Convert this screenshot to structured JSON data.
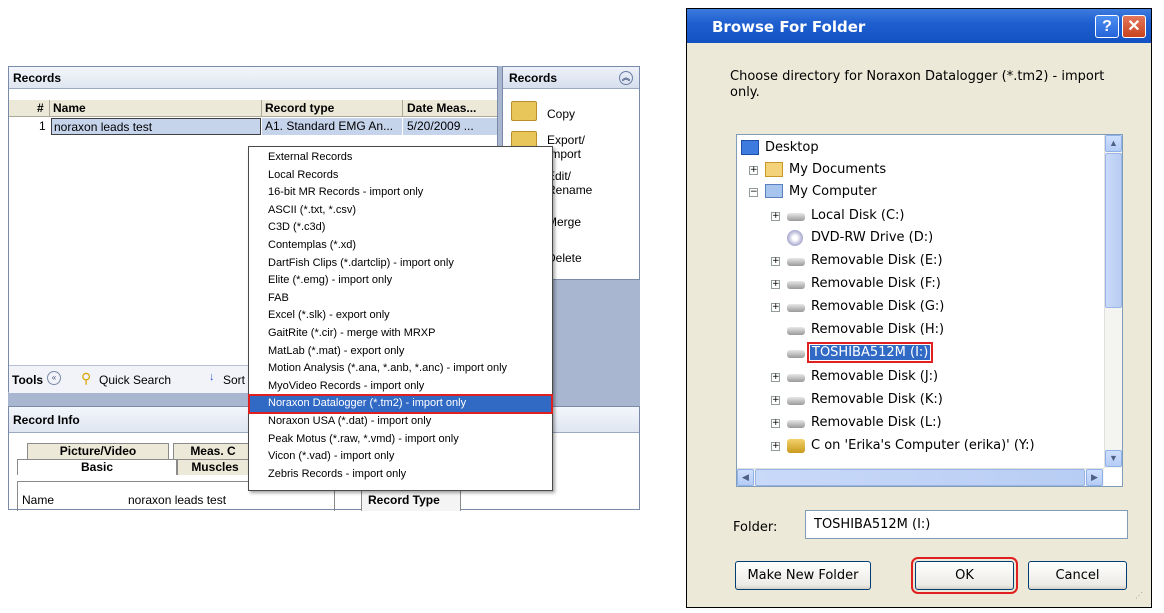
{
  "app": {
    "records_panel": {
      "title": "Records",
      "columns": [
        "#",
        "Name",
        "Record type",
        "Date Meas..."
      ],
      "rows": [
        {
          "num": "1",
          "name": "noraxon leads test",
          "type": "A1. Standard EMG An...",
          "date": "5/20/2009 ..."
        }
      ]
    },
    "tools_bar": {
      "tools_label": "Tools",
      "quick_search": "Quick Search",
      "sort": "Sort"
    },
    "side_panel": {
      "title": "Records",
      "items": [
        {
          "label": "Copy"
        },
        {
          "label": "Export/ Import"
        },
        {
          "label": "Edit/ Rename"
        },
        {
          "label": "Merge"
        },
        {
          "label": "Delete"
        }
      ]
    },
    "record_info": {
      "title": "Record Info",
      "tabs_top": [
        "Picture/Video",
        "Meas. C"
      ],
      "tabs_bottom": [
        "Basic",
        "Muscles"
      ],
      "name_label": "Name",
      "name_value": "noraxon leads test",
      "record_type_label": "Record Type"
    },
    "context_menu": {
      "items": [
        "External Records",
        "Local Records",
        "16-bit MR Records - import only",
        "ASCII (*.txt, *.csv)",
        "C3D (*.c3d)",
        "Contemplas (*.xd)",
        "DartFish Clips (*.dartclip) - import only",
        "Elite (*.emg) - import only",
        "FAB",
        "Excel (*.slk) - export only",
        "GaitRite (*.cir) - merge with MRXP",
        "MatLab (*.mat) - export only",
        "Motion Analysis (*.ana, *.anb, *.anc) - import only",
        "MyoVideo Records - import only",
        "Noraxon Datalogger (*.tm2) - import only",
        "Noraxon USA (*.dat) - import only",
        "Peak Motus (*.raw, *.vmd) - import only",
        "Vicon (*.vad) - import only",
        "Zebris Records - import only"
      ],
      "highlighted": "Noraxon Datalogger (*.tm2) - import only"
    }
  },
  "dialog": {
    "title": "Browse For Folder",
    "help_glyph": "?",
    "close_glyph": "✕",
    "instruction": "Choose directory for Noraxon Datalogger (*.tm2) - import only.",
    "tree": [
      {
        "label": "Desktop",
        "icon": "desktop-icon"
      },
      {
        "label": "My Documents",
        "icon": "my-documents-icon"
      },
      {
        "label": "My Computer",
        "icon": "my-computer-icon"
      },
      {
        "label": "Local Disk (C:)",
        "icon": "local-disk-icon"
      },
      {
        "label": "DVD-RW Drive (D:)",
        "icon": "dvd-drive-icon"
      },
      {
        "label": "Removable Disk (E:)",
        "icon": "removable-disk-icon"
      },
      {
        "label": "Removable Disk (F:)",
        "icon": "removable-disk-icon"
      },
      {
        "label": "Removable Disk (G:)",
        "icon": "removable-disk-icon"
      },
      {
        "label": "Removable Disk (H:)",
        "icon": "removable-disk-icon"
      },
      {
        "label": "TOSHIBA512M (I:)",
        "icon": "removable-disk-icon"
      },
      {
        "label": "Removable Disk (J:)",
        "icon": "removable-disk-icon"
      },
      {
        "label": "Removable Disk (K:)",
        "icon": "removable-disk-icon"
      },
      {
        "label": "Removable Disk (L:)",
        "icon": "removable-disk-icon"
      },
      {
        "label": "C on 'Erika's Computer (erika)' (Y:)",
        "icon": "network-drive-icon"
      }
    ],
    "selected": "TOSHIBA512M (I:)",
    "folder_label": "Folder:",
    "folder_value": "TOSHIBA512M (I:)",
    "buttons": {
      "make_new_folder": "Make New Folder",
      "ok": "OK",
      "cancel": "Cancel"
    }
  },
  "colors": {
    "titlebar": "#1f5fcf",
    "selection": "#316ac5",
    "highlight_box": "#e02020",
    "app_background": "#a9b6cf"
  }
}
